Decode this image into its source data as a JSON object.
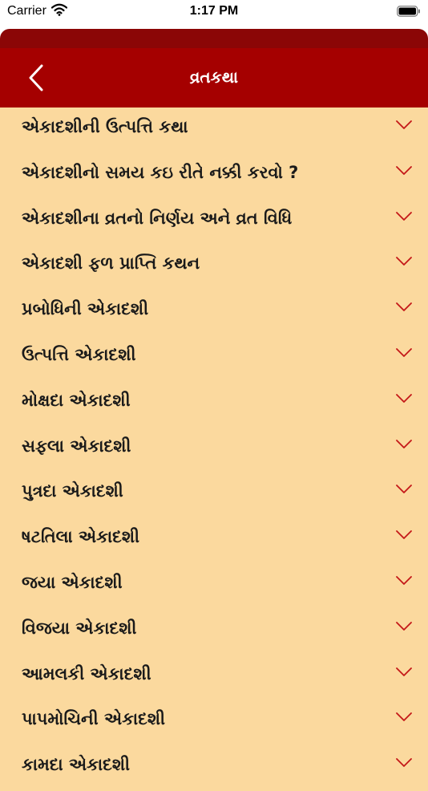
{
  "status_bar": {
    "carrier": "Carrier",
    "time": "1:17 PM"
  },
  "header": {
    "title": "વ્રતકથા"
  },
  "colors": {
    "nav": "#a50000",
    "background": "#fbd99e",
    "chevron": "#c41818"
  },
  "items": [
    {
      "label": "એકાદશીની ઉત્પત્તિ કથા"
    },
    {
      "label": "એકાદશીનો સમય કઇ રીતે નક્કી કરવો ?"
    },
    {
      "label": "એકાદશીના વ્રતનો નિર્ણય અને વ્રત વિધિ"
    },
    {
      "label": "એકાદશી ફળ પ્રાપ્તિ કથન"
    },
    {
      "label": "પ્રબોધિની એકાદશી"
    },
    {
      "label": "ઉત્પત્તિ એકાદશી"
    },
    {
      "label": "મોક્ષદા એકાદશી"
    },
    {
      "label": "સફલા એકાદશી"
    },
    {
      "label": "પુત્રદા એકાદશી"
    },
    {
      "label": "ષટતિલા એકાદશી"
    },
    {
      "label": "જયા એકાદશી"
    },
    {
      "label": "વિજયા એકાદશી"
    },
    {
      "label": "આમલકી એકાદશી"
    },
    {
      "label": "પાપમોચિની એકાદશી"
    },
    {
      "label": "કામદા એકાદશી"
    }
  ]
}
